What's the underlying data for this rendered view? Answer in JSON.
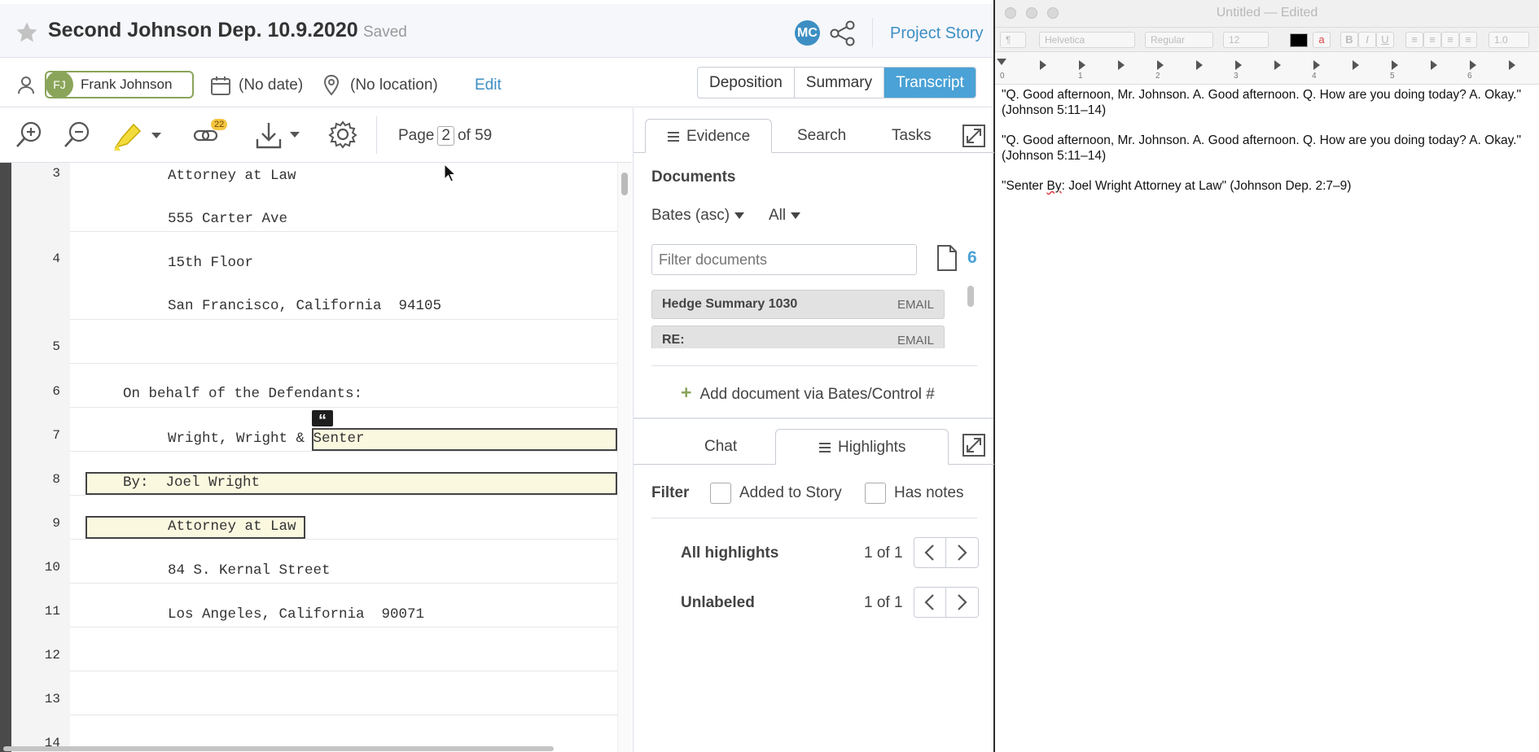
{
  "app": {
    "title": "Second Johnson Dep. 10.9.2020",
    "save_status": "Saved",
    "user_initials": "MC",
    "project_story_label": "Project Story"
  },
  "meta": {
    "witness_initials": "FJ",
    "witness_name": "Frank Johnson",
    "date": "(No date)",
    "location": "(No location)",
    "edit_label": "Edit",
    "view_tabs": [
      {
        "label": "Deposition",
        "active": false
      },
      {
        "label": "Summary",
        "active": false
      },
      {
        "label": "Transcript",
        "active": true
      }
    ]
  },
  "toolbar": {
    "links_badge": "22",
    "page_prefix": "Page",
    "page_current": "2",
    "page_suffix": "of 59"
  },
  "transcript": {
    "lines": [
      {
        "num": "3",
        "text1": "Attorney at Law",
        "text2": "555 Carter Ave"
      },
      {
        "num": "4",
        "text1": "15th Floor",
        "text2": "San Francisco, California  94105"
      },
      {
        "num": "5",
        "text1": "",
        "text2": ""
      },
      {
        "num": "6",
        "text1": "On behalf of the Defendants:",
        "text2": ""
      },
      {
        "num": "7",
        "text1": "Wright, Wright & Senter",
        "text2": ""
      },
      {
        "num": "8",
        "text1": "By:  Joel Wright",
        "text2": ""
      },
      {
        "num": "9",
        "text1": "Attorney at Law",
        "text2": ""
      },
      {
        "num": "10",
        "text1": "84 S. Kernal Street",
        "text2": ""
      },
      {
        "num": "11",
        "text1": "Los Angeles, California  90071",
        "text2": ""
      },
      {
        "num": "12",
        "text1": "",
        "text2": ""
      },
      {
        "num": "13",
        "text1": "",
        "text2": ""
      },
      {
        "num": "14",
        "text1": "",
        "text2": ""
      }
    ],
    "quote_flag": "“"
  },
  "evidence": {
    "tabs": [
      {
        "label": "Evidence",
        "active": true
      },
      {
        "label": "Search",
        "active": false
      },
      {
        "label": "Tasks",
        "active": false
      }
    ],
    "documents_title": "Documents",
    "sort_label": "Bates (asc)",
    "filter_label": "All",
    "filter_placeholder": "Filter documents",
    "doc_count": "6",
    "documents": [
      {
        "name": "Hedge Summary 1030",
        "type": "EMAIL"
      },
      {
        "name": "RE:",
        "type": "EMAIL"
      }
    ],
    "add_document_label": "Add document via Bates/Control #"
  },
  "highlights": {
    "tabs": [
      {
        "label": "Chat",
        "active": false
      },
      {
        "label": "Highlights",
        "active": true
      }
    ],
    "filter_label": "Filter",
    "checkbox_story": "Added to Story",
    "checkbox_notes": "Has notes",
    "rows": [
      {
        "label": "All highlights",
        "count": "1 of 1"
      },
      {
        "label": "Unlabeled",
        "count": "1 of 1"
      }
    ]
  },
  "textedit": {
    "window_title": "Untitled",
    "window_subtitle": " — Edited",
    "paragraph_style": "¶",
    "font_family": "Helvetica",
    "font_style": "Regular",
    "font_size": "12",
    "line_spacing": "1.0",
    "ruler_numbers": [
      "0",
      "1",
      "2",
      "3",
      "4",
      "5",
      "6"
    ],
    "paragraphs": [
      "\"Q. Good afternoon, Mr. Johnson. A. Good afternoon. Q. How are you doing today? A. Okay.\" (Johnson 5:11–14)",
      "\"Q. Good afternoon, Mr. Johnson. A. Good afternoon. Q. How are you doing today? A. Okay.\" (Johnson 5:11–14)"
    ],
    "last_paragraph_pre": "\"Senter ",
    "last_paragraph_squiggle": "By",
    "last_paragraph_post": ": Joel Wright Attorney at Law\" (Johnson Dep. 2:7–9)"
  }
}
